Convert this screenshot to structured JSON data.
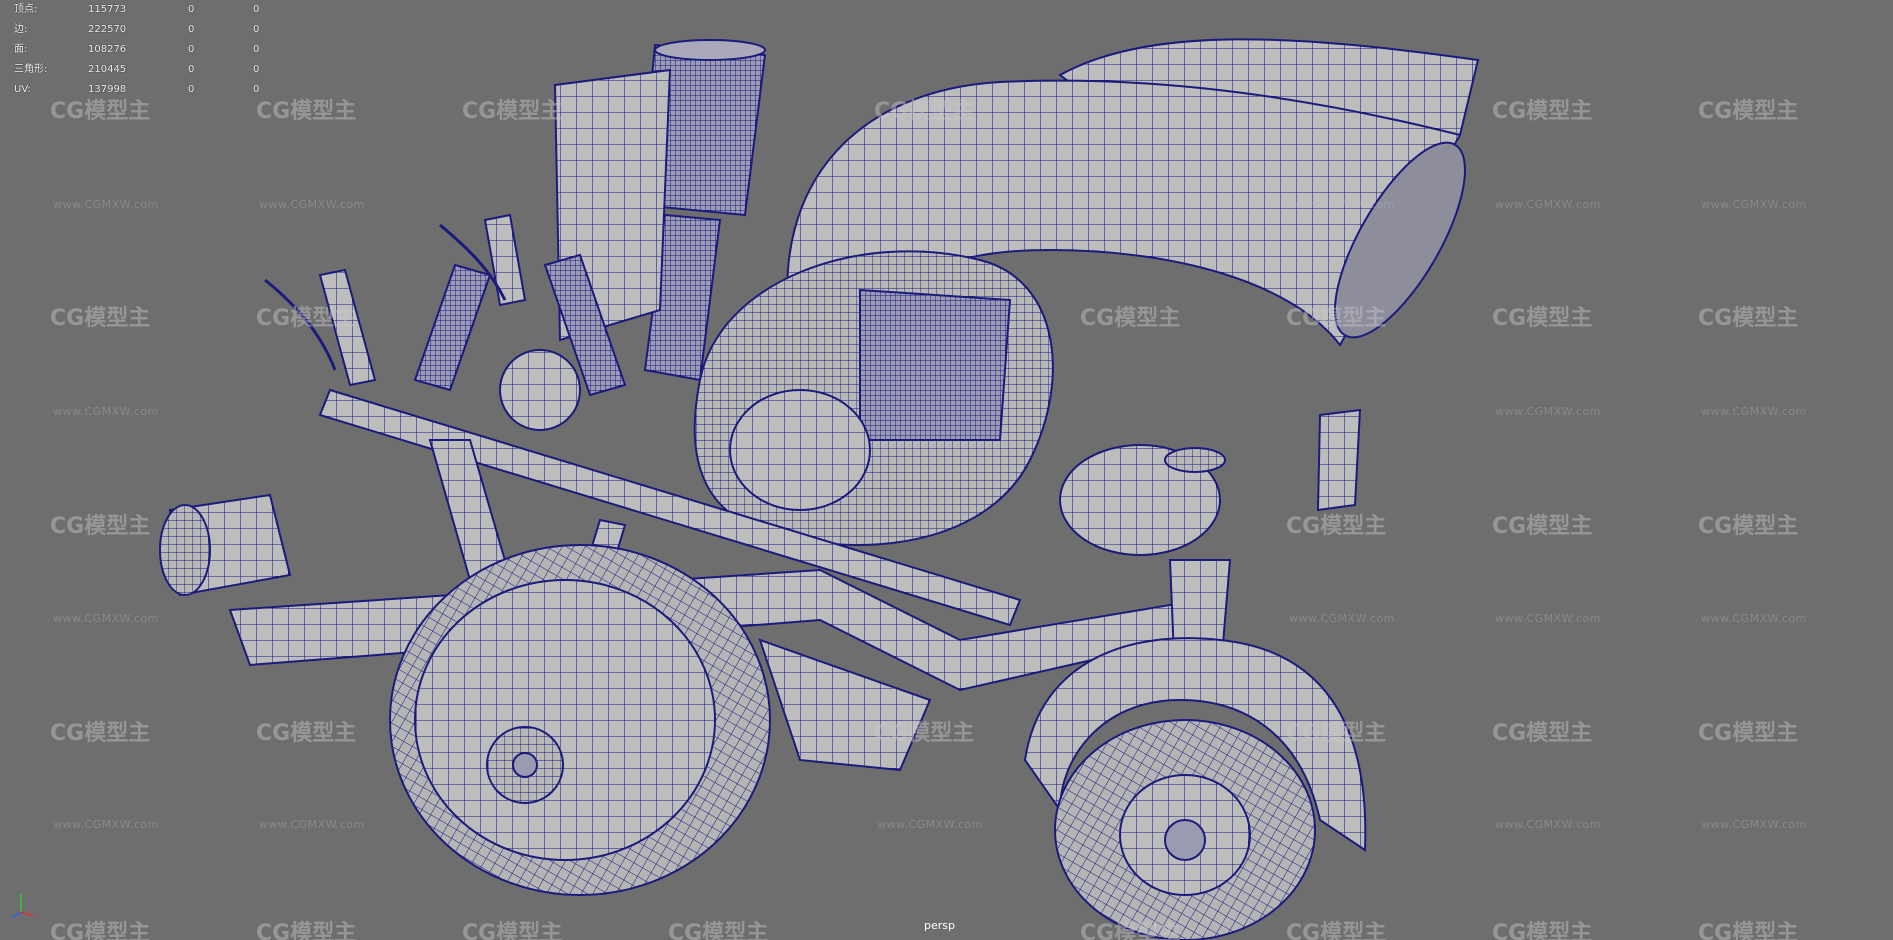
{
  "hud": {
    "rows": [
      {
        "label": "顶点:",
        "v1": "115773",
        "v2": "0",
        "v3": "0"
      },
      {
        "label": "边:",
        "v1": "222570",
        "v2": "0",
        "v3": "0"
      },
      {
        "label": "面:",
        "v1": "108276",
        "v2": "0",
        "v3": "0"
      },
      {
        "label": "三角形:",
        "v1": "210445",
        "v2": "0",
        "v3": "0"
      },
      {
        "label": "UV:",
        "v1": "137998",
        "v2": "0",
        "v3": "0"
      }
    ]
  },
  "watermark": {
    "logo": "CG模型主",
    "url": "www.CGMXW.com"
  },
  "viewport": {
    "camera": "persp"
  },
  "colors": {
    "background": "#6e6e6e",
    "wire": "#1a1a7a",
    "surface": "#bcbcbc",
    "axis_x": "#e03030",
    "axis_y": "#30d030",
    "axis_z": "#3060f0"
  },
  "icons": {
    "axis_gizmo": "xyz-axis-icon"
  }
}
